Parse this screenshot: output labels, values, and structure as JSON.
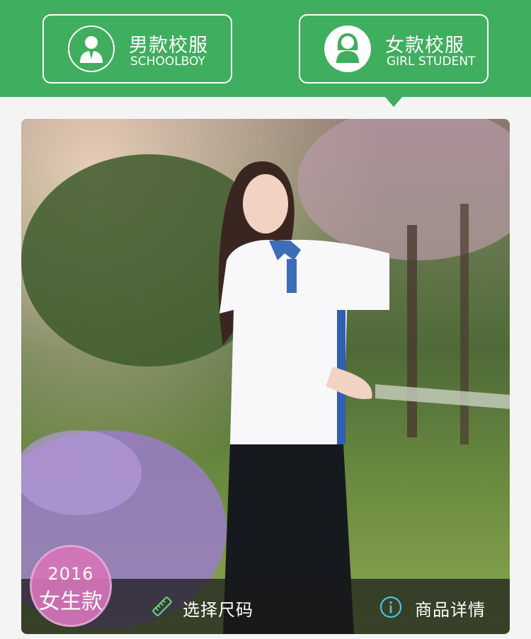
{
  "tabs": {
    "boy": {
      "title": "男款校服",
      "subtitle": "SCHOOLBOY",
      "icon": "boy-avatar-icon"
    },
    "girl": {
      "title": "女款校服",
      "subtitle": "GIRL STUDENT",
      "icon": "girl-avatar-icon",
      "selected": true
    }
  },
  "badge": {
    "year": "2016",
    "label": "女生款"
  },
  "actions": {
    "size": {
      "label": "选择尺码",
      "icon": "ruler-icon"
    },
    "detail": {
      "label": "商品详情",
      "icon": "info-icon"
    }
  },
  "colors": {
    "brand_green": "#3fae5e",
    "badge_pink": "#d674ba"
  }
}
